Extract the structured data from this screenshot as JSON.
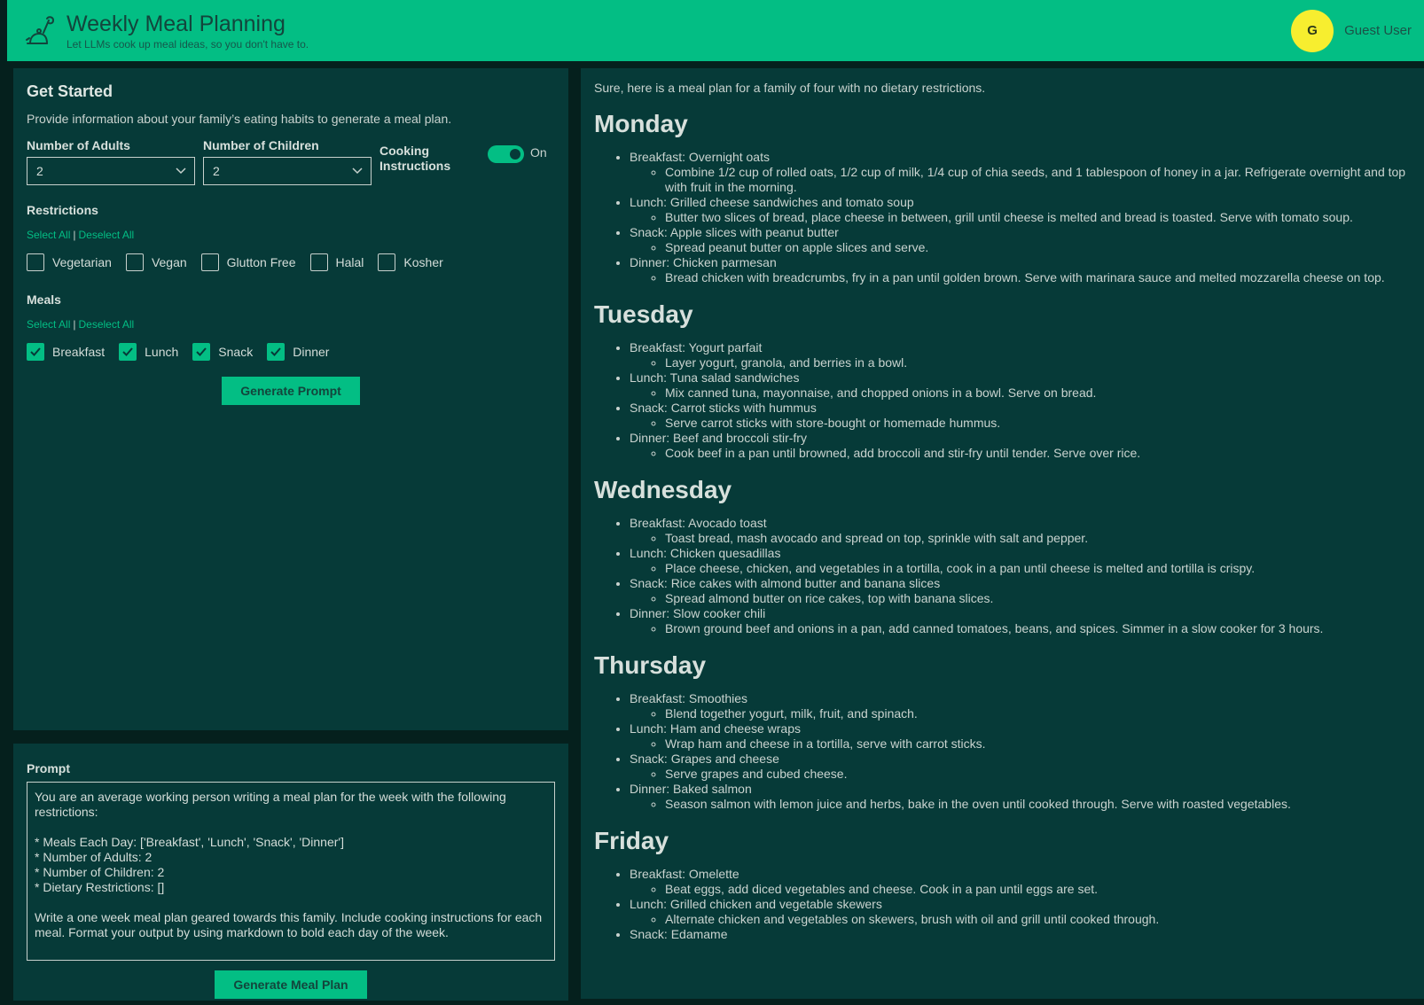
{
  "header": {
    "title": "Weekly Meal Planning",
    "subtitle": "Let LLMs cook up meal ideas, so you don't have to.",
    "avatar_letter": "G",
    "user_name": "Guest User"
  },
  "form": {
    "heading": "Get Started",
    "description": "Provide information about your family’s eating habits to generate a meal plan.",
    "adults_label": "Number of Adults",
    "adults_value": "2",
    "children_label": "Number of Children",
    "children_value": "2",
    "cooking_label": "Cooking Instructions",
    "cooking_state": "On",
    "restrictions_label": "Restrictions",
    "select_all": "Select All",
    "deselect_all": "Deselect All",
    "separator": "|",
    "restrictions": [
      {
        "label": "Vegetarian",
        "checked": false
      },
      {
        "label": "Vegan",
        "checked": false
      },
      {
        "label": "Glutton Free",
        "checked": false
      },
      {
        "label": "Halal",
        "checked": false
      },
      {
        "label": "Kosher",
        "checked": false
      }
    ],
    "meals_label": "Meals",
    "meals": [
      {
        "label": "Breakfast",
        "checked": true
      },
      {
        "label": "Lunch",
        "checked": true
      },
      {
        "label": "Snack",
        "checked": true
      },
      {
        "label": "Dinner",
        "checked": true
      }
    ],
    "generate_prompt_label": "Generate Prompt"
  },
  "prompt": {
    "label": "Prompt",
    "text": "You are an average working person writing a meal plan for the week with the following restrictions:\n\n* Meals Each Day: ['Breakfast', 'Lunch', 'Snack', 'Dinner']\n* Number of Adults: 2\n* Number of Children: 2\n* Dietary Restrictions: []\n\nWrite a one week meal plan geared towards this family. Include cooking instructions for each meal. Format your output by using markdown to bold each day of the week.",
    "generate_plan_label": "Generate Meal Plan"
  },
  "plan": {
    "intro": "Sure, here is a meal plan for a family of four with no dietary restrictions.",
    "days": [
      {
        "name": "Monday",
        "meals": [
          {
            "title": "Breakfast: Overnight oats",
            "detail": "Combine 1/2 cup of rolled oats, 1/2 cup of milk, 1/4 cup of chia seeds, and 1 tablespoon of honey in a jar. Refrigerate overnight and top with fruit in the morning."
          },
          {
            "title": "Lunch: Grilled cheese sandwiches and tomato soup",
            "detail": "Butter two slices of bread, place cheese in between, grill until cheese is melted and bread is toasted. Serve with tomato soup."
          },
          {
            "title": "Snack: Apple slices with peanut butter",
            "detail": "Spread peanut butter on apple slices and serve."
          },
          {
            "title": "Dinner: Chicken parmesan",
            "detail": "Bread chicken with breadcrumbs, fry in a pan until golden brown. Serve with marinara sauce and melted mozzarella cheese on top."
          }
        ]
      },
      {
        "name": "Tuesday",
        "meals": [
          {
            "title": "Breakfast: Yogurt parfait",
            "detail": "Layer yogurt, granola, and berries in a bowl."
          },
          {
            "title": "Lunch: Tuna salad sandwiches",
            "detail": "Mix canned tuna, mayonnaise, and chopped onions in a bowl. Serve on bread."
          },
          {
            "title": "Snack: Carrot sticks with hummus",
            "detail": "Serve carrot sticks with store-bought or homemade hummus."
          },
          {
            "title": "Dinner: Beef and broccoli stir-fry",
            "detail": "Cook beef in a pan until browned, add broccoli and stir-fry until tender. Serve over rice."
          }
        ]
      },
      {
        "name": "Wednesday",
        "meals": [
          {
            "title": "Breakfast: Avocado toast",
            "detail": "Toast bread, mash avocado and spread on top, sprinkle with salt and pepper."
          },
          {
            "title": "Lunch: Chicken quesadillas",
            "detail": "Place cheese, chicken, and vegetables in a tortilla, cook in a pan until cheese is melted and tortilla is crispy."
          },
          {
            "title": "Snack: Rice cakes with almond butter and banana slices",
            "detail": "Spread almond butter on rice cakes, top with banana slices."
          },
          {
            "title": "Dinner: Slow cooker chili",
            "detail": "Brown ground beef and onions in a pan, add canned tomatoes, beans, and spices. Simmer in a slow cooker for 3 hours."
          }
        ]
      },
      {
        "name": "Thursday",
        "meals": [
          {
            "title": "Breakfast: Smoothies",
            "detail": "Blend together yogurt, milk, fruit, and spinach."
          },
          {
            "title": "Lunch: Ham and cheese wraps",
            "detail": "Wrap ham and cheese in a tortilla, serve with carrot sticks."
          },
          {
            "title": "Snack: Grapes and cheese",
            "detail": "Serve grapes and cubed cheese."
          },
          {
            "title": "Dinner: Baked salmon",
            "detail": "Season salmon with lemon juice and herbs, bake in the oven until cooked through. Serve with roasted vegetables."
          }
        ]
      },
      {
        "name": "Friday",
        "meals": [
          {
            "title": "Breakfast: Omelette",
            "detail": "Beat eggs, add diced vegetables and cheese. Cook in a pan until eggs are set."
          },
          {
            "title": "Lunch: Grilled chicken and vegetable skewers",
            "detail": "Alternate chicken and vegetables on skewers, brush with oil and grill until cooked through."
          },
          {
            "title": "Snack: Edamame",
            "detail": ""
          }
        ]
      }
    ]
  },
  "colors": {
    "accent": "#03be84",
    "panel": "#063a38",
    "background": "#05201d",
    "avatar": "#f7ee2f"
  }
}
